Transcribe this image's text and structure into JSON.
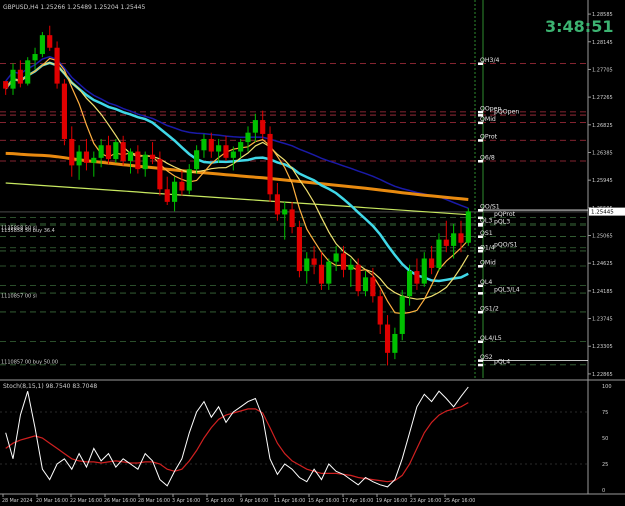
{
  "symbol_header": "GBPUSD,H4  1.25266 1.25489 1.25204 1.25445",
  "countdown": "3:48:51",
  "indicator_header": "Stoch(8,15,1) 98.7540 83.7048",
  "levels": [
    {
      "label": "QH3/4",
      "price": 1.278,
      "color": "#b03040",
      "style": "dash"
    },
    {
      "label": "QOpen",
      "price": 1.2703,
      "color": "#b03040",
      "style": "dash"
    },
    {
      "label": "pQOpen",
      "price": 1.2698,
      "color": "#b03040",
      "style": "dash"
    },
    {
      "label": "QMid",
      "price": 1.2686,
      "color": "#b03040",
      "style": "dash"
    },
    {
      "label": "QProt",
      "price": 1.2658,
      "color": "#b03040",
      "style": "dash"
    },
    {
      "label": "Q6/8",
      "price": 1.2625,
      "color": "#b03040",
      "style": "dash"
    },
    {
      "label": "QO/S1",
      "price": 1.2547,
      "color": "#ffffff",
      "style": "solid"
    },
    {
      "label": "pQProt",
      "price": 1.2535,
      "color": "#3a6a3a",
      "style": "dash"
    },
    {
      "label": "QL3",
      "price": 1.2525,
      "color": "#3a6a3a",
      "style": "dash"
    },
    {
      "label": "pQL3",
      "price": 1.2523,
      "color": "#3a6a3a",
      "style": "dash"
    },
    {
      "label": "QS1",
      "price": 1.2505,
      "color": "#3a6a3a",
      "style": "dash"
    },
    {
      "label": "pQO/S1",
      "price": 1.2487,
      "color": "#3a6a3a",
      "style": "dash"
    },
    {
      "label": "Q1/4",
      "price": 1.2482,
      "color": "#3a6a3a",
      "style": "dash"
    },
    {
      "label": "QMid",
      "price": 1.2458,
      "color": "#3a6a3a",
      "style": "dash"
    },
    {
      "label": "QL4",
      "price": 1.2427,
      "color": "#3a6a3a",
      "style": "dash"
    },
    {
      "label": "pQL3/L4",
      "price": 1.2415,
      "color": "#3a6a3a",
      "style": "dash"
    },
    {
      "label": "QS1/2",
      "price": 1.2385,
      "color": "#3a6a3a",
      "style": "dash"
    },
    {
      "label": "QL4/L5",
      "price": 1.2338,
      "color": "#3a6a3a",
      "style": "dash"
    },
    {
      "label": "QS2",
      "price": 1.2308,
      "color": "#ffffff",
      "style": "solid"
    },
    {
      "label": "pQL4",
      "price": 1.2301,
      "color": "#3a6a3a",
      "style": "dash"
    }
  ],
  "left_order_labels": [
    {
      "text": "1135858 50 sl",
      "price": 1.2516
    },
    {
      "text": "1135858 50 buy 36.4",
      "price": 1.2512
    },
    {
      "text": "1110857 00 sl",
      "price": 1.2408
    },
    {
      "text": "1110857 00 buy 50.00",
      "price": 1.2303
    }
  ],
  "price_axis": {
    "min": 1.228,
    "max": 1.2865,
    "ticks": [
      "1.28585",
      "1.28145",
      "1.27705",
      "1.27265",
      "1.26825",
      "1.26385",
      "1.25945",
      "1.25505",
      "1.25065",
      "1.24625",
      "1.24185",
      "1.23745",
      "1.23305",
      "1.22865"
    ],
    "current": "1.25445"
  },
  "stoch_axis": {
    "ticks": [
      "100",
      "75",
      "50",
      "25",
      "0"
    ]
  },
  "time_axis": [
    "28 Mar 2024",
    "20 Mar 16:00",
    "22 Mar 16:00",
    "26 Mar 16:00",
    "28 Mar 16:00",
    "3 Apr 16:00",
    "5 Apr 16:00",
    "9 Apr 16:00",
    "11 Apr 16:00",
    "15 Apr 16:00",
    "17 Apr 16:00",
    "19 Apr 16:00",
    "23 Apr 16:00",
    "25 Apr 16:00"
  ],
  "colors": {
    "background": "#000000",
    "bull": "#00c000",
    "bear": "#e00000",
    "ma_blue": "#1a1aa8",
    "ma_orange": "#e88a10",
    "ma_cyan": "#40d8e8",
    "ma_yellow": "#f0e070",
    "ma_lime": "#c8e860",
    "ma_lightorange": "#ffb040",
    "stoch_main": "#ffffff",
    "stoch_signal": "#d02020",
    "countdown": "#3cb371"
  },
  "chart_data": {
    "type": "candlestick",
    "ohlc_approx": [
      [
        1.2752,
        1.2748,
        1.273,
        1.274
      ],
      [
        1.274,
        1.278,
        1.273,
        1.277
      ],
      [
        1.277,
        1.2785,
        1.2742,
        1.2748
      ],
      [
        1.2748,
        1.279,
        1.2745,
        1.2785
      ],
      [
        1.2785,
        1.2805,
        1.277,
        1.2795
      ],
      [
        1.2795,
        1.283,
        1.279,
        1.2825
      ],
      [
        1.2825,
        1.284,
        1.28,
        1.2805
      ],
      [
        1.2805,
        1.2815,
        1.274,
        1.2748
      ],
      [
        1.2748,
        1.2755,
        1.265,
        1.266
      ],
      [
        1.266,
        1.268,
        1.26,
        1.2618
      ],
      [
        1.2618,
        1.265,
        1.2595,
        1.264
      ],
      [
        1.264,
        1.266,
        1.261,
        1.2622
      ],
      [
        1.2622,
        1.264,
        1.26,
        1.263
      ],
      [
        1.263,
        1.266,
        1.2615,
        1.265
      ],
      [
        1.265,
        1.2665,
        1.262,
        1.2628
      ],
      [
        1.2628,
        1.266,
        1.2622,
        1.2655
      ],
      [
        1.2655,
        1.2665,
        1.2618,
        1.2625
      ],
      [
        1.2625,
        1.2645,
        1.2605,
        1.264
      ],
      [
        1.264,
        1.265,
        1.2605,
        1.2612
      ],
      [
        1.2612,
        1.264,
        1.26,
        1.2635
      ],
      [
        1.2635,
        1.2655,
        1.262,
        1.2628
      ],
      [
        1.2628,
        1.264,
        1.257,
        1.258
      ],
      [
        1.258,
        1.26,
        1.2555,
        1.256
      ],
      [
        1.256,
        1.26,
        1.2545,
        1.2592
      ],
      [
        1.2592,
        1.261,
        1.257,
        1.2578
      ],
      [
        1.2578,
        1.262,
        1.2572,
        1.2612
      ],
      [
        1.2612,
        1.265,
        1.2605,
        1.2642
      ],
      [
        1.2642,
        1.2668,
        1.263,
        1.266
      ],
      [
        1.266,
        1.267,
        1.263,
        1.264
      ],
      [
        1.264,
        1.266,
        1.2622,
        1.265
      ],
      [
        1.265,
        1.2665,
        1.2625,
        1.263
      ],
      [
        1.263,
        1.2648,
        1.261,
        1.264
      ],
      [
        1.264,
        1.266,
        1.263,
        1.2655
      ],
      [
        1.2655,
        1.268,
        1.264,
        1.267
      ],
      [
        1.267,
        1.27,
        1.2655,
        1.269
      ],
      [
        1.269,
        1.2705,
        1.266,
        1.2668
      ],
      [
        1.2668,
        1.268,
        1.256,
        1.2572
      ],
      [
        1.2572,
        1.259,
        1.253,
        1.254
      ],
      [
        1.254,
        1.256,
        1.25,
        1.2548
      ],
      [
        1.2548,
        1.256,
        1.251,
        1.252
      ],
      [
        1.252,
        1.253,
        1.244,
        1.245
      ],
      [
        1.245,
        1.248,
        1.243,
        1.247
      ],
      [
        1.247,
        1.249,
        1.2445,
        1.246
      ],
      [
        1.246,
        1.248,
        1.242,
        1.243
      ],
      [
        1.243,
        1.247,
        1.242,
        1.2465
      ],
      [
        1.2465,
        1.249,
        1.245,
        1.2478
      ],
      [
        1.2478,
        1.249,
        1.244,
        1.2452
      ],
      [
        1.2452,
        1.247,
        1.2425,
        1.246
      ],
      [
        1.246,
        1.247,
        1.241,
        1.2418
      ],
      [
        1.2418,
        1.245,
        1.241,
        1.244
      ],
      [
        1.244,
        1.2455,
        1.24,
        1.241
      ],
      [
        1.241,
        1.242,
        1.235,
        1.2365
      ],
      [
        1.2365,
        1.238,
        1.23,
        1.232
      ],
      [
        1.232,
        1.236,
        1.231,
        1.235
      ],
      [
        1.235,
        1.242,
        1.234,
        1.241
      ],
      [
        1.241,
        1.246,
        1.2395,
        1.245
      ],
      [
        1.245,
        1.247,
        1.242,
        1.243
      ],
      [
        1.243,
        1.248,
        1.2425,
        1.247
      ],
      [
        1.247,
        1.249,
        1.2445,
        1.2455
      ],
      [
        1.2455,
        1.251,
        1.245,
        1.25
      ],
      [
        1.25,
        1.253,
        1.248,
        1.249
      ],
      [
        1.249,
        1.2525,
        1.247,
        1.251
      ],
      [
        1.251,
        1.253,
        1.248,
        1.2495
      ],
      [
        1.2495,
        1.255,
        1.249,
        1.2545
      ]
    ],
    "stoch_main_approx": [
      55,
      30,
      72,
      95,
      60,
      20,
      10,
      25,
      30,
      20,
      35,
      22,
      40,
      28,
      35,
      22,
      30,
      25,
      20,
      35,
      28,
      10,
      4,
      18,
      30,
      55,
      75,
      85,
      70,
      80,
      65,
      75,
      80,
      85,
      88,
      70,
      30,
      15,
      25,
      20,
      12,
      8,
      20,
      10,
      25,
      18,
      15,
      10,
      5,
      12,
      8,
      5,
      3,
      10,
      30,
      55,
      80,
      92,
      85,
      95,
      88,
      80,
      90,
      99
    ],
    "stoch_signal_approx": [
      40,
      45,
      48,
      50,
      52,
      50,
      45,
      40,
      35,
      30,
      28,
      27,
      27,
      26,
      27,
      28,
      27,
      26,
      26,
      27,
      27,
      25,
      20,
      18,
      20,
      28,
      38,
      50,
      60,
      68,
      72,
      74,
      76,
      78,
      78,
      74,
      60,
      45,
      35,
      28,
      24,
      20,
      18,
      16,
      16,
      16,
      15,
      14,
      12,
      11,
      10,
      9,
      8,
      9,
      14,
      25,
      40,
      55,
      65,
      72,
      76,
      78,
      80,
      84
    ]
  }
}
